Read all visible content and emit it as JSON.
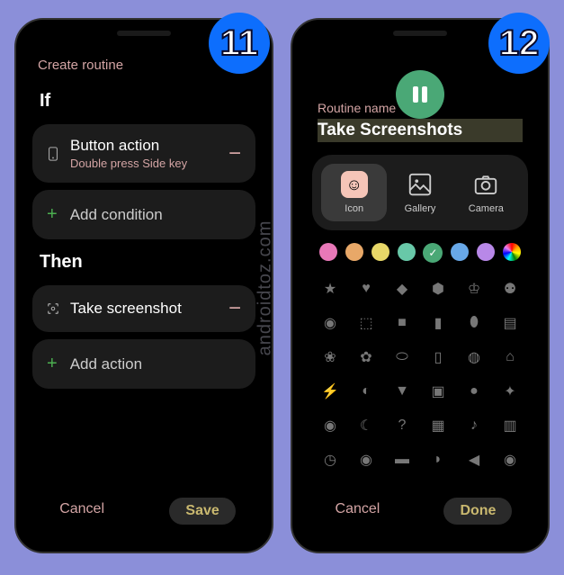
{
  "watermark": "androidtoz.com",
  "badges": {
    "left": "11",
    "right": "12"
  },
  "screen1": {
    "header": "Create routine",
    "if_label": "If",
    "then_label": "Then",
    "condition": {
      "title": "Button action",
      "subtitle": "Double press Side key"
    },
    "add_condition": "Add condition",
    "action": {
      "title": "Take screenshot"
    },
    "add_action": "Add action",
    "cancel": "Cancel",
    "save": "Save"
  },
  "screen2": {
    "name_label": "Routine name",
    "name_value": "Take Screenshots",
    "tabs": [
      {
        "label": "Icon",
        "icon": "face"
      },
      {
        "label": "Gallery",
        "icon": "gallery"
      },
      {
        "label": "Camera",
        "icon": "camera"
      }
    ],
    "colors": [
      "#e878b8",
      "#e8a868",
      "#e8d868",
      "#68c8a8",
      "#4aa876",
      "#68a8e8",
      "#b888e8",
      "rainbow"
    ],
    "selected_color_index": 4,
    "icons": [
      "star",
      "heart",
      "diamond",
      "bear",
      "crown",
      "robot",
      "bot",
      "puzzle",
      "gift",
      "bottle",
      "controller",
      "cart",
      "leaf",
      "flower",
      "bone",
      "fork",
      "food",
      "home",
      "lightning",
      "paint",
      "drink",
      "basket",
      "ball",
      "paw",
      "bulb",
      "moon",
      "help",
      "building",
      "music",
      "print",
      "clock",
      "pin",
      "car",
      "chat",
      "speaker",
      "group",
      "bag",
      "screen",
      "cup",
      "play",
      "check",
      "pencil"
    ],
    "selected_icon_index": 40,
    "cancel": "Cancel",
    "done": "Done"
  }
}
